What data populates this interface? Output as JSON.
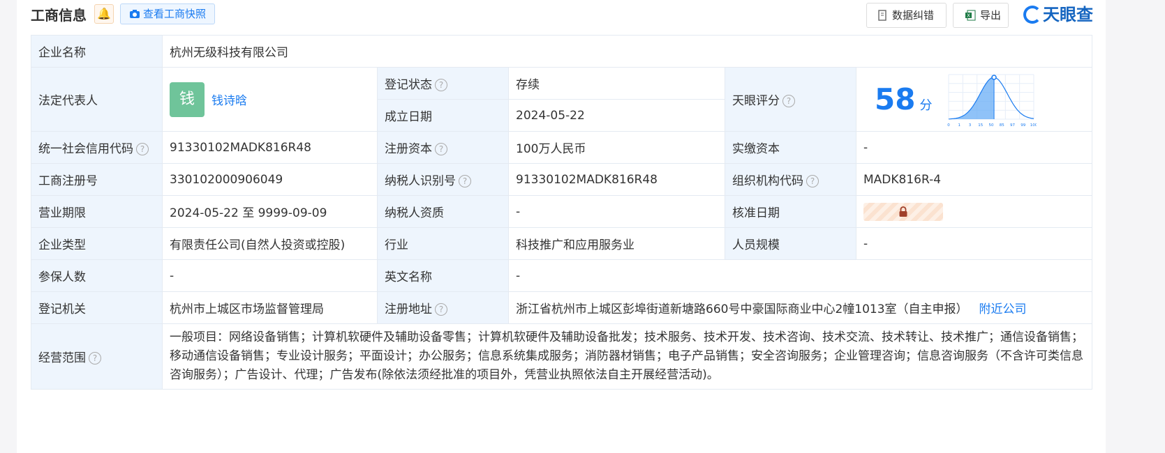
{
  "header": {
    "title": "工商信息",
    "snapshot_btn": "查看工商快照",
    "correct_btn": "数据纠错",
    "export_btn": "导出",
    "logo_text": "天眼查"
  },
  "fields": {
    "company_name_label": "企业名称",
    "company_name": "杭州无级科技有限公司",
    "legal_rep_label": "法定代表人",
    "legal_rep_avatar": "钱",
    "legal_rep": "钱诗晗",
    "reg_status_label": "登记状态",
    "reg_status": "存续",
    "found_date_label": "成立日期",
    "found_date": "2024-05-22",
    "tianyan_score_label": "天眼评分",
    "score": "58",
    "score_unit": "分",
    "credit_code_label": "统一社会信用代码",
    "credit_code": "91330102MADK816R48",
    "reg_capital_label": "注册资本",
    "reg_capital": "100万人民币",
    "paid_capital_label": "实缴资本",
    "paid_capital": "-",
    "reg_no_label": "工商注册号",
    "reg_no": "330102000906049",
    "taxpayer_id_label": "纳税人识别号",
    "taxpayer_id": "91330102MADK816R48",
    "org_code_label": "组织机构代码",
    "org_code": "MADK816R-4",
    "term_label": "营业期限",
    "term": "2024-05-22 至 9999-09-09",
    "taxpayer_qual_label": "纳税人资质",
    "taxpayer_qual": "-",
    "approve_date_label": "核准日期",
    "type_label": "企业类型",
    "type": "有限责任公司(自然人投资或控股)",
    "industry_label": "行业",
    "industry": "科技推广和应用服务业",
    "staff_label": "人员规模",
    "staff": "-",
    "insured_label": "参保人数",
    "insured": "-",
    "english_label": "英文名称",
    "english": "-",
    "authority_label": "登记机关",
    "authority": "杭州市上城区市场监督管理局",
    "address_label": "注册地址",
    "address": "浙江省杭州市上城区彭埠街道新塘路660号中豪国际商业中心2幢1013室（自主申报）",
    "nearby_link": "附近公司",
    "scope_label": "经营范围",
    "scope": "一般项目：网络设备销售；计算机软硬件及辅助设备零售；计算机软硬件及辅助设备批发；技术服务、技术开发、技术咨询、技术交流、技术转让、技术推广；通信设备销售；移动通信设备销售；专业设计服务；平面设计；办公服务；信息系统集成服务；消防器材销售；电子产品销售；安全咨询服务；企业管理咨询；信息咨询服务（不含许可类信息咨询服务）；广告设计、代理；广告发布(除依法须经批准的项目外，凭营业执照依法自主开展经营活动)。"
  },
  "score_chart": {
    "ticks": [
      "0",
      "1",
      "3",
      "15",
      "50",
      "85",
      "97",
      "99",
      "100"
    ]
  },
  "colors": {
    "link_blue": "#1a7bf0",
    "status_green": "#10a050",
    "label_bg": "#eef5fd",
    "avatar_green": "#6fc49a"
  },
  "icons": [
    "bell-icon",
    "camera-icon",
    "edit-doc-icon",
    "excel-icon",
    "help-icon",
    "lock-icon"
  ]
}
